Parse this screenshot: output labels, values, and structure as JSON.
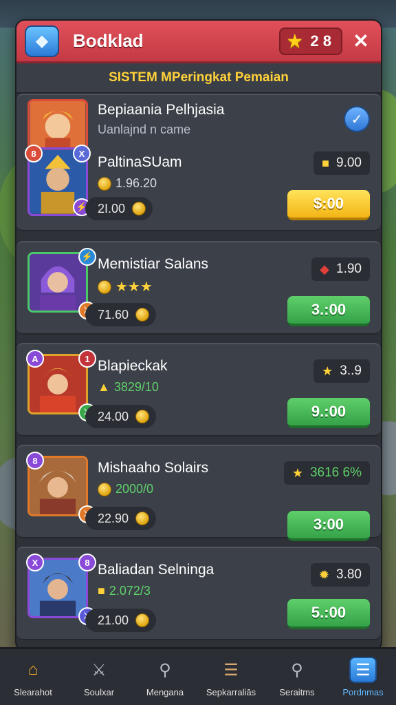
{
  "header": {
    "title": "Bodklad",
    "star_count": "2 8",
    "close_icon": "close-icon",
    "app_icon": "mask-icon"
  },
  "subheader": "SISTEM MPeringkat Pemaian",
  "cards": [
    {
      "title": "Bepiaania Pelhjasia",
      "subtitle": "Uanlajnd n came",
      "name": "PaltinaSUam",
      "stat": "1.96.20",
      "price": "2I.00",
      "tag": "9.00",
      "button": "$:00",
      "badge_left": "8",
      "badge_right": "X",
      "checked": true
    },
    {
      "name": "Memistiar Salans",
      "stars": 3,
      "price": "71.60",
      "tag": "1.90",
      "button": "3.:00"
    },
    {
      "name": "Blapieckak",
      "stat": "3829/10",
      "price": "24.00",
      "tag": "3..9",
      "button": "9.:00",
      "badge_left": "A",
      "badge_right": "1"
    },
    {
      "name": "Mishaaho Solairs",
      "stat": "2000/0",
      "price": "22.90",
      "tag": "3616 6%",
      "button": "3:00",
      "badge_left": "8"
    },
    {
      "name": "Baliadan Selninga",
      "stat": "2.072/3",
      "price": "21.00",
      "tag": "3.80",
      "button": "5.:00",
      "badge_left": "X",
      "badge_right": "8"
    }
  ],
  "nav": [
    {
      "label": "Slearahot",
      "icon": "house-icon"
    },
    {
      "label": "Soulxar",
      "icon": "sword-icon"
    },
    {
      "label": "Mengana",
      "icon": "search-icon"
    },
    {
      "label": "Sepkarraliās",
      "icon": "scroll-icon"
    },
    {
      "label": "Seraitms",
      "icon": "search-icon"
    },
    {
      "label": "Pordnmas",
      "icon": "list-icon"
    }
  ],
  "colors": {
    "header_red": "#d8464f",
    "button_green": "#34a247",
    "button_yellow": "#f3b515",
    "nav_active": "#62b8ff"
  }
}
